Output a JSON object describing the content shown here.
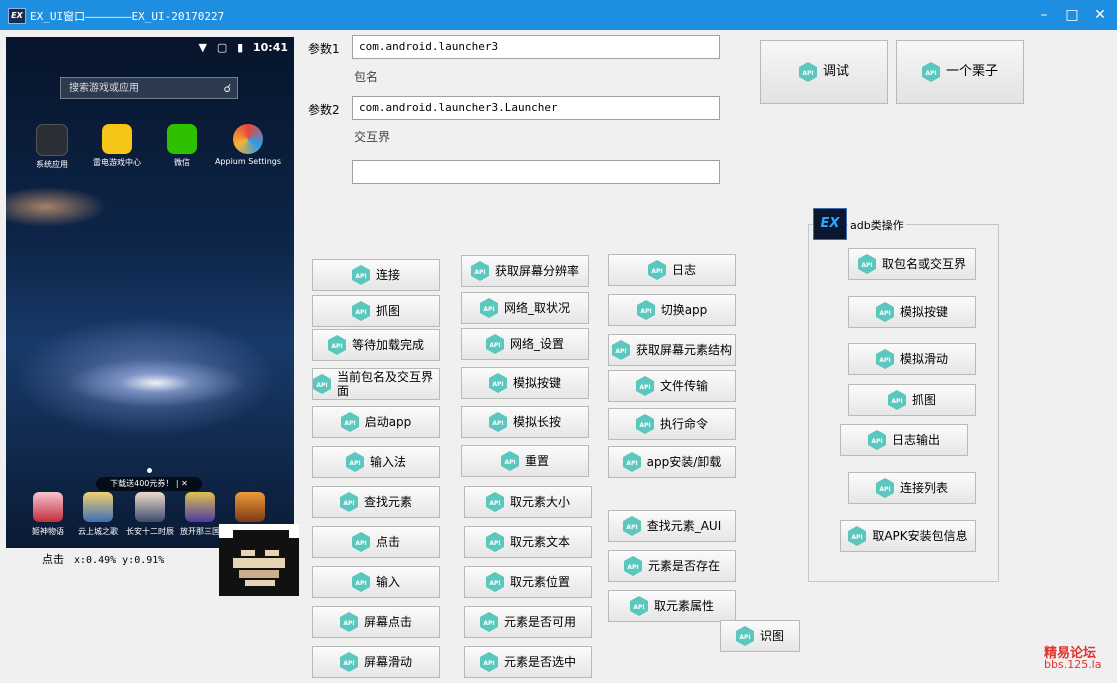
{
  "window": {
    "title": "EX_UI窗口———————EX_UI-20170227",
    "icon": "ex-app-icon",
    "controls": [
      "minimize-icon",
      "maximize-icon",
      "close-icon"
    ]
  },
  "phone": {
    "time": "10:41",
    "search_placeholder": "搜索游戏或应用",
    "apps": [
      "系统应用",
      "雷电游戏中心",
      "微信",
      "Appium Settings"
    ],
    "promo": "下载送400元券！  |  ✕",
    "dock": [
      "姬神物语",
      "云上城之歌",
      "长安十二时辰",
      "放开那三国"
    ]
  },
  "coord": {
    "label": "点击",
    "value": "x:0.49% y:0.91%"
  },
  "params": {
    "p1_label": "参数1",
    "p1_value": "com.android.launcher3",
    "p1_hint": "包名",
    "p2_label": "参数2",
    "p2_value": "com.android.launcher3.Launcher",
    "p2_hint": "交互界",
    "p3_value": ""
  },
  "top_buttons": {
    "debug": "调试",
    "example": "一个栗子"
  },
  "col1": [
    "连接",
    "抓图",
    "等待加载完成",
    "当前包名及交互界面",
    "启动app",
    "输入法",
    "查找元素",
    "点击",
    "输入",
    "屏幕点击",
    "屏幕滑动"
  ],
  "col2": [
    "获取屏幕分辨率",
    "网络_取状况",
    "网络_设置",
    "模拟按键",
    "模拟长按",
    "重置",
    "取元素大小",
    "取元素文本",
    "取元素位置",
    "元素是否可用",
    "元素是否选中"
  ],
  "col3": [
    "日志",
    "切换app",
    "获取屏幕元素结构",
    "文件传输",
    "执行命令",
    "app安装/卸载",
    "查找元素_AUI",
    "元素是否存在",
    "取元素属性",
    "识图"
  ],
  "adb": {
    "title": "adb类操作",
    "logo": "EX",
    "buttons": [
      "取包名或交互界",
      "模拟按键",
      "模拟滑动",
      "抓图",
      "日志输出",
      "连接列表",
      "取APK安装包信息"
    ]
  },
  "badge": "API",
  "watermark": {
    "line1": "精易论坛",
    "line2": "bbs.125.la"
  },
  "colors": {
    "titlebar": "#1e8ee0",
    "api_badge": "#5cc7bf",
    "watermark": "#e0332c"
  }
}
